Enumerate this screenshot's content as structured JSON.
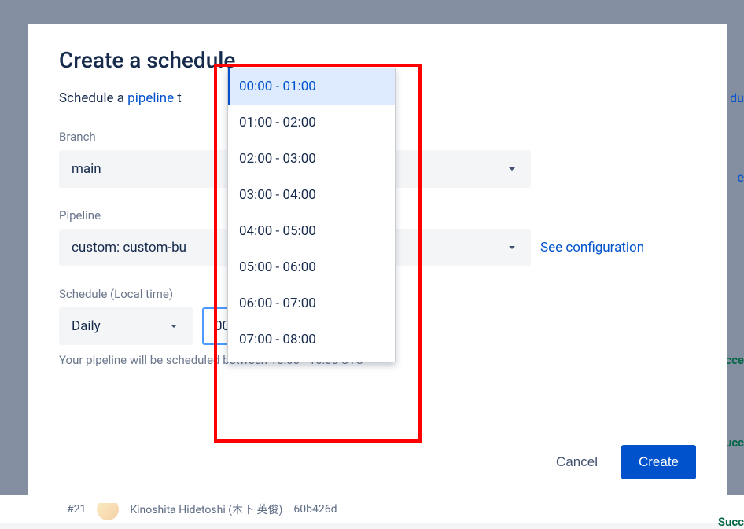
{
  "modal": {
    "title": "Create a schedule",
    "subtitle_prefix": "Schedule a ",
    "subtitle_link": "pipeline",
    "subtitle_suffix": " t",
    "fields": {
      "branch": {
        "label": "Branch",
        "value": "main"
      },
      "pipeline": {
        "label": "Pipeline",
        "value": "custom: custom-bu",
        "config_link": "See configuration"
      },
      "schedule": {
        "label": "Schedule (Local time)",
        "frequency_value": "Daily",
        "time_value": "00:00 - 01:00"
      }
    },
    "helper_text": "Your pipeline will be scheduled between 15:00 - 16:00 UTC",
    "actions": {
      "cancel": "Cancel",
      "create": "Create"
    }
  },
  "dropdown": {
    "selected_index": 0,
    "options": [
      "00:00 - 01:00",
      "01:00 - 02:00",
      "02:00 - 03:00",
      "03:00 - 04:00",
      "04:00 - 05:00",
      "05:00 - 06:00",
      "06:00 - 07:00",
      "07:00 - 08:00"
    ]
  },
  "background": {
    "row_pr": "#21",
    "row_author": "Kinoshita Hidetoshi (木下 英俊)",
    "row_commit": "60b426d",
    "badge_success": "Succ",
    "side_du": "du",
    "side_e": "e",
    "side_cce": "cce"
  }
}
